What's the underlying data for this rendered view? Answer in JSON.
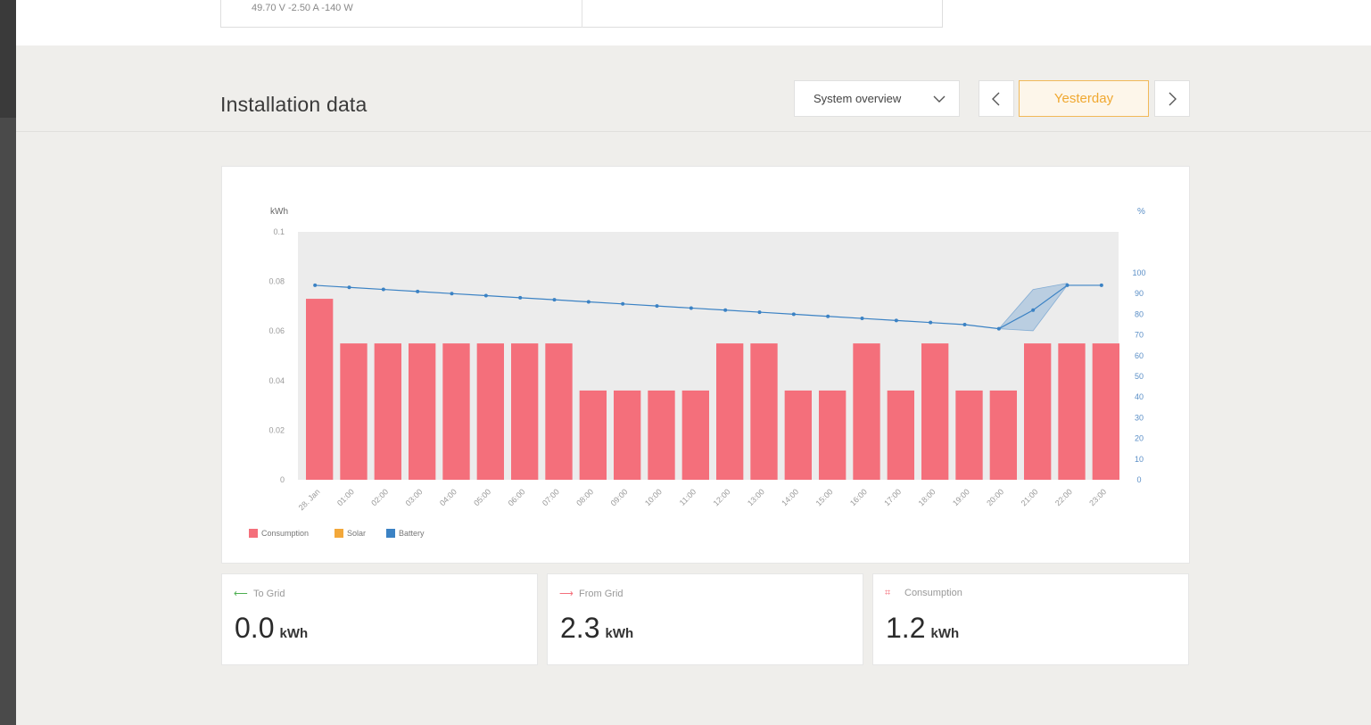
{
  "top_card": {
    "readout": "49.70 V   -2.50 A   -140 W"
  },
  "page": {
    "title": "Installation data"
  },
  "controls": {
    "view_select": "System overview",
    "period": "Yesterday",
    "prev_icon": "chevron-left-icon",
    "next_icon": "chevron-right-icon",
    "dropdown_icon": "chevron-down-icon"
  },
  "colors": {
    "consumption": "#f46f7b",
    "solar": "#f3a83a",
    "battery": "#3b82c4",
    "accent": "#f0a830",
    "to_grid": "#4caf50",
    "from_grid": "#f46f7b"
  },
  "chart_data": {
    "type": "bar",
    "left_unit": "kWh",
    "right_unit": "%",
    "y_left_ticks": [
      "0.1",
      "0.08",
      "0.06",
      "0.04",
      "0.02",
      "0"
    ],
    "y_right_ticks": [
      "100",
      "90",
      "80",
      "70",
      "60",
      "50",
      "40",
      "30",
      "20",
      "10",
      "0"
    ],
    "ylim_left": [
      0,
      0.1
    ],
    "ylim_right": [
      0,
      100
    ],
    "categories": [
      "28. Jan",
      "01:00",
      "02:00",
      "03:00",
      "04:00",
      "05:00",
      "06:00",
      "07:00",
      "08:00",
      "09:00",
      "10:00",
      "11:00",
      "12:00",
      "13:00",
      "14:00",
      "15:00",
      "16:00",
      "17:00",
      "18:00",
      "19:00",
      "20:00",
      "21:00",
      "22:00",
      "23:00"
    ],
    "series": [
      {
        "name": "Consumption",
        "axis": "left",
        "type": "bar",
        "values": [
          0.073,
          0.055,
          0.055,
          0.055,
          0.055,
          0.055,
          0.055,
          0.055,
          0.036,
          0.036,
          0.036,
          0.036,
          0.055,
          0.055,
          0.036,
          0.036,
          0.055,
          0.036,
          0.055,
          0.036,
          0.036,
          0.055,
          0.055,
          0.055
        ]
      },
      {
        "name": "Solar",
        "axis": "left",
        "type": "bar",
        "values": []
      },
      {
        "name": "Battery",
        "axis": "right",
        "type": "line",
        "values": [
          94,
          93,
          92,
          91,
          90,
          89,
          88,
          87,
          86,
          85,
          84,
          83,
          82,
          81,
          80,
          79,
          78,
          77,
          76,
          75,
          73,
          82,
          94,
          94
        ],
        "band_min": [
          null,
          null,
          null,
          null,
          null,
          null,
          null,
          null,
          null,
          null,
          null,
          null,
          null,
          null,
          null,
          null,
          null,
          null,
          null,
          null,
          73,
          72,
          94,
          null
        ],
        "band_max": [
          null,
          null,
          null,
          null,
          null,
          null,
          null,
          null,
          null,
          null,
          null,
          null,
          null,
          null,
          null,
          null,
          null,
          null,
          null,
          null,
          73,
          92,
          95,
          null
        ]
      }
    ],
    "legend": [
      "Consumption",
      "Solar",
      "Battery"
    ],
    "legend_position": "bottom-left",
    "grid": false
  },
  "stats": [
    {
      "label": "To Grid",
      "value": "0.0",
      "unit": "kWh",
      "icon": "arrow-left-icon",
      "icon_glyph": "⟵"
    },
    {
      "label": "From Grid",
      "value": "2.3",
      "unit": "kWh",
      "icon": "arrow-right-icon",
      "icon_glyph": "⟶"
    },
    {
      "label": "Consumption",
      "value": "1.2",
      "unit": "kWh",
      "icon": "consumption-icon",
      "icon_glyph": "⌗"
    }
  ]
}
